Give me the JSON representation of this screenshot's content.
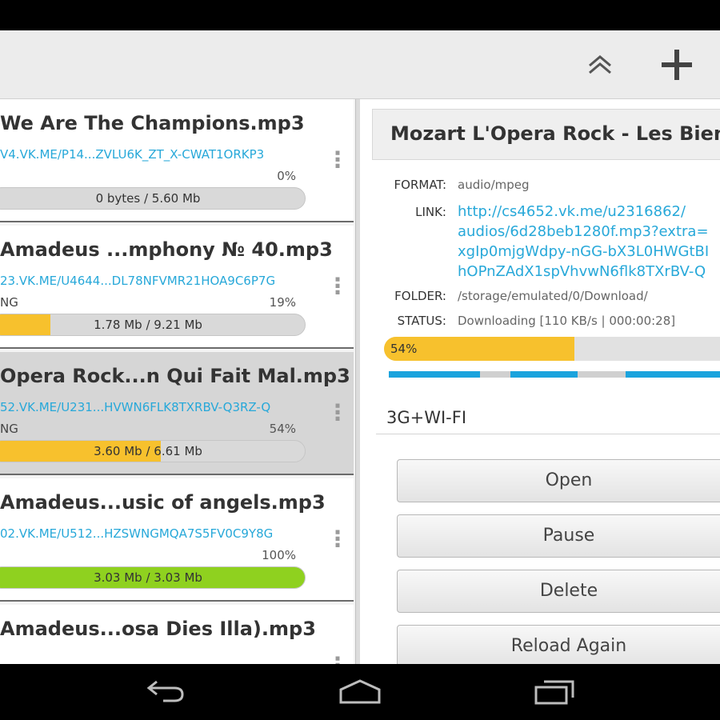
{
  "action_bar": {
    "icons": [
      "collapse-up-icon",
      "plus-icon"
    ]
  },
  "downloads": [
    {
      "title": "We Are The Champions.mp3",
      "link": "V4.VK.ME/P14...ZVLU6K_ZT_X-CWAT1ORKP3",
      "status": "",
      "percent": "0%",
      "progress": 0,
      "size_text": "0 bytes / 5.60 Mb",
      "bar_color": "#f7c12d",
      "selected": false
    },
    {
      "title": "Amadeus ...mphony № 40.mp3",
      "link": "23.VK.ME/U4644...DL78NFVMR21HOA9C6P7G",
      "status": "NG",
      "percent": "19%",
      "progress": 0.19,
      "size_text": "1.78 Mb / 9.21 Mb",
      "bar_color": "#f7c12d",
      "selected": false
    },
    {
      "title": "Opera Rock...n Qui Fait Mal.mp3",
      "link": "52.VK.ME/U231...HVWN6FLK8TXRBV-Q3RZ-Q",
      "status": "NG",
      "percent": "54%",
      "progress": 0.54,
      "size_text": "3.60 Mb / 6.61 Mb",
      "bar_color": "#f7c12d",
      "selected": true
    },
    {
      "title": "Amadeus...usic of angels.mp3",
      "link": "02.VK.ME/U512...HZSWNGMQA7S5FV0C9Y8G",
      "status": "",
      "percent": "100%",
      "progress": 1,
      "size_text": "3.03 Mb / 3.03 Mb",
      "bar_color": "#8fd11f",
      "selected": false
    },
    {
      "title": "Amadeus...osa Dies Illa).mp3",
      "link": "",
      "status": "",
      "percent": "",
      "progress": 0,
      "size_text": "",
      "bar_color": "#f7c12d",
      "selected": false
    }
  ],
  "detail": {
    "title": "Mozart L'Opera Rock - Les Bien Qu",
    "format_label": "FORMAT:",
    "format_value": "audio/mpeg",
    "link_label": "LINK:",
    "link_lines": [
      "http://cs4652.vk.me/u2316862/",
      "audios/6d28beb1280f.mp3?extra=",
      "xgIp0mjgWdpy-nGG-bX3L0HWGtBI",
      "hOPnZAdX1spVhvwN6flk8TXrBV-Q"
    ],
    "folder_label": "FOLDER:",
    "folder_value": "/storage/emulated/0/Download/",
    "status_label": "STATUS:",
    "status_value": "Downloading [110 KB/s | 000:00:28]",
    "progress_text": "54%",
    "progress": 0.54,
    "segments_colors": [
      "#1aa3dd",
      "#d0d0d0"
    ],
    "network": "3G+WI-FI",
    "buttons": [
      "Open",
      "Pause",
      "Delete",
      "Reload Again"
    ]
  },
  "nav_bar": {
    "icons": [
      "back-icon",
      "home-icon",
      "recents-icon"
    ]
  }
}
